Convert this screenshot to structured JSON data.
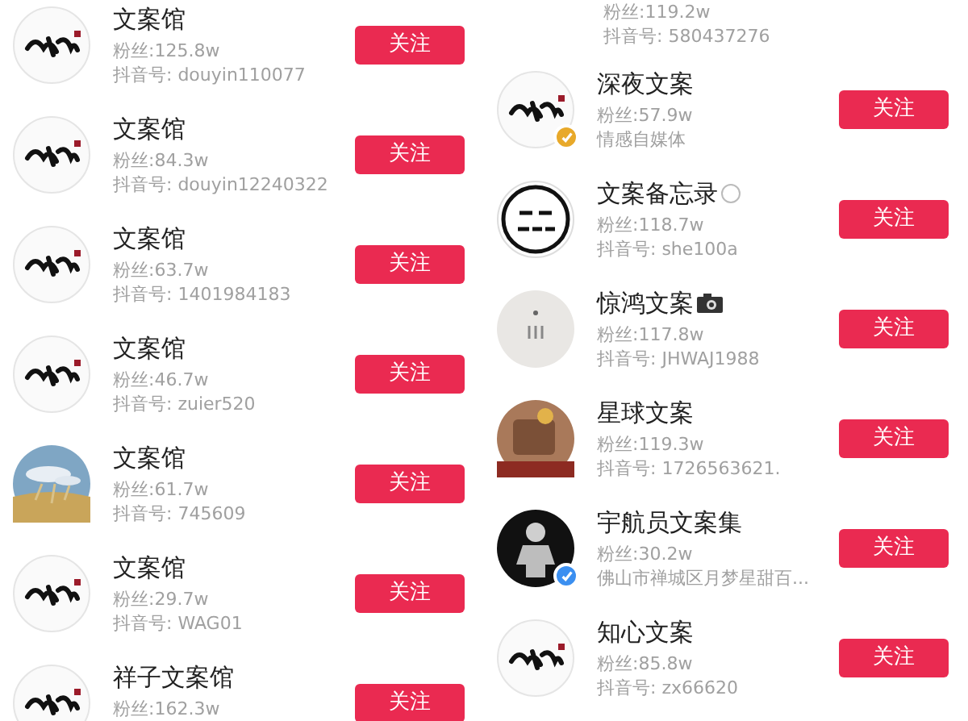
{
  "left_column": [
    {
      "name": "文案馆",
      "verified": false,
      "fans": "粉丝:125.8w",
      "detail": "抖音号: douyin110077",
      "button": "关注"
    },
    {
      "name": "文案馆",
      "verified": false,
      "fans": "粉丝:84.3w",
      "detail": "抖音号: douyin12240322",
      "button": "关注"
    },
    {
      "name": "文案馆",
      "verified": false,
      "fans": "粉丝:63.7w",
      "detail": "抖音号: 1401984183",
      "button": "关注"
    },
    {
      "name": "文案馆",
      "verified": false,
      "fans": "粉丝:46.7w",
      "detail": "抖音号: zuier520",
      "button": "关注"
    },
    {
      "name": "文案馆",
      "verified": false,
      "fans": "粉丝:61.7w",
      "detail": "抖音号: 745609",
      "button": "关注"
    },
    {
      "name": "文案馆",
      "verified": false,
      "fans": "粉丝:29.7w",
      "detail": "抖音号: WAG01",
      "button": "关注"
    },
    {
      "name": "祥子文案馆",
      "verified": false,
      "fans": "粉丝:162.3w",
      "button": "关注"
    }
  ],
  "right_column": {
    "partial_row": {
      "fans": "粉丝:119.2w",
      "detail": "抖音号: 580437276"
    },
    "rows": [
      {
        "name": "深夜文案",
        "verified": true,
        "color": "#e8a92a",
        "fans": "粉丝:57.9w",
        "detail": "情感自媒体",
        "button": "关注"
      },
      {
        "name": "文案备忘录",
        "kind": "circle",
        "verified": false,
        "fans": "粉丝:118.7w",
        "detail": "抖音号: she100a",
        "button": "关注"
      },
      {
        "name": "惊鸿文案",
        "kind": "camera",
        "verified": false,
        "fans": "粉丝:117.8w",
        "detail": "抖音号: JHWAJ1988",
        "button": "关注"
      },
      {
        "name": "星球文案",
        "verified": false,
        "fans": "粉丝:119.3w",
        "detail": "抖音号: 1726563621.",
        "button": "关注"
      },
      {
        "name": "宇航员文案集",
        "verified": true,
        "color": "#3b8ff0",
        "fans": "粉丝:30.2w",
        "detail": "佛山市禅城区月梦星甜百...",
        "button": "关注"
      },
      {
        "name": "知心文案",
        "verified": false,
        "fans": "粉丝:85.8w",
        "detail": "抖音号: zx66620",
        "button": "关注"
      }
    ]
  }
}
